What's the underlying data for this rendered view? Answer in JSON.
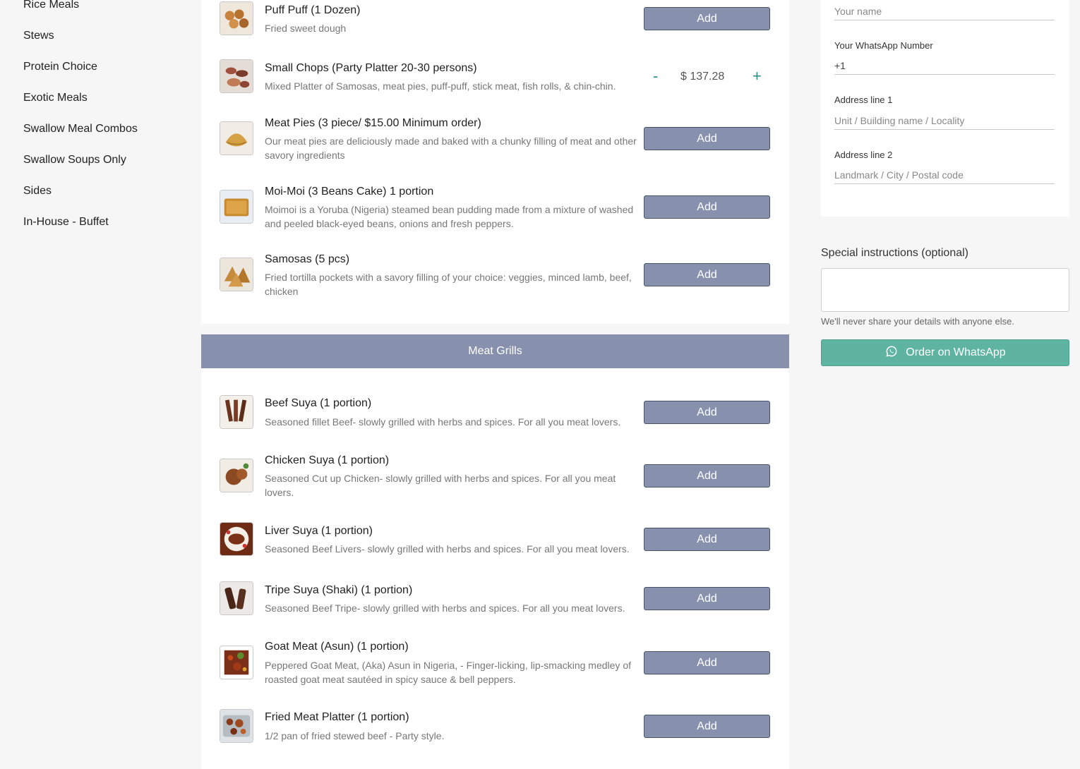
{
  "categories": [
    "Rice Meals",
    "Stews",
    "Protein Choice",
    "Exotic Meals",
    "Swallow Meal Combos",
    "Swallow Soups Only",
    "Sides",
    "In-House - Buffet"
  ],
  "section_meat_grills": "Meat Grills",
  "add_label": "Add",
  "items_top": [
    {
      "name": "Puff Puff (1 Dozen)",
      "desc": "Fried sweet dough"
    },
    {
      "name": "Small Chops (Party Platter 20-30 persons)",
      "desc": "Mixed Platter of Samosas, meat pies, puff-puff, stick meat, fish rolls, & chin-chin.",
      "qty_minus": "-",
      "price": "$ 137.28",
      "qty_plus": "+"
    },
    {
      "name": "Meat Pies (3 piece/ $15.00 Minimum order)",
      "desc": "Our meat pies are deliciously made and baked with a chunky filling of meat and other savory ingredients"
    },
    {
      "name": "Moi-Moi (3 Beans Cake) 1 portion",
      "desc": "Moimoi is a Yoruba (Nigeria) steamed bean pudding made from a mixture of washed and peeled black-eyed beans, onions and fresh peppers."
    },
    {
      "name": "Samosas (5 pcs)",
      "desc": "Fried tortilla pockets with a savory filling of your choice: veggies, minced lamb, beef, chicken"
    }
  ],
  "items_grills": [
    {
      "name": "Beef Suya (1 portion)",
      "desc": "Seasoned fillet Beef- slowly grilled with herbs and spices. For all you meat lovers."
    },
    {
      "name": "Chicken Suya (1 portion)",
      "desc": "Seasoned Cut up Chicken- slowly grilled with herbs and spices. For all you meat lovers."
    },
    {
      "name": "Liver Suya (1 portion)",
      "desc": "Seasoned Beef Livers- slowly grilled with herbs and spices. For all you meat lovers."
    },
    {
      "name": "Tripe Suya (Shaki) (1 portion)",
      "desc": "Seasoned Beef Tripe- slowly grilled with herbs and spices. For all you meat lovers."
    },
    {
      "name": "Goat Meat (Asun) (1 portion)",
      "desc": "Peppered Goat Meat, (Aka) Asun in Nigeria, - Finger-licking, lip-smacking medley of roasted goat meat sautéed in spicy sauce & bell peppers."
    },
    {
      "name": "Fried Meat Platter (1 portion)",
      "desc": "1/2 pan of fried stewed beef - Party style."
    }
  ],
  "form": {
    "name_placeholder": "Your name",
    "whatsapp_label": "Your WhatsApp Number",
    "whatsapp_value": "+1",
    "address1_label": "Address line 1",
    "address1_placeholder": "Unit / Building name / Locality",
    "address2_label": "Address line 2",
    "address2_placeholder": "Landmark / City / Postal code"
  },
  "special_instructions_label": "Special instructions (optional)",
  "privacy_note": "We'll never share your details with anyone else.",
  "order_button_label": "Order on WhatsApp",
  "icons": {
    "whatsapp": "whatsapp-icon"
  },
  "colors": {
    "accent": "#8791ae",
    "whatsapp": "#5fb4a1",
    "qty": "#2f8f86"
  }
}
